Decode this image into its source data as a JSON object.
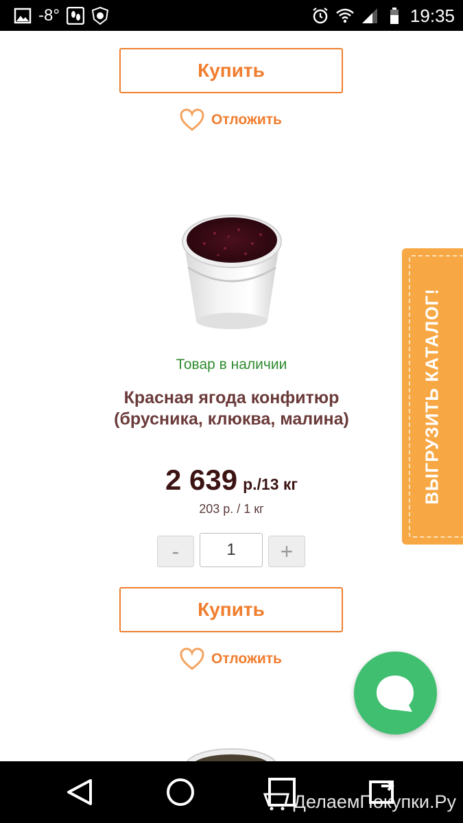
{
  "status_bar": {
    "temperature": "-8°",
    "time": "19:35",
    "icons": [
      "image-icon",
      "footprints-icon",
      "antivirus-icon",
      "alarm-icon",
      "wifi-icon",
      "signal-icon",
      "battery-icon"
    ]
  },
  "previous_product": {
    "buy_label": "Купить",
    "postpone_label": "Отложить"
  },
  "product": {
    "availability": "Товар в наличии",
    "title": "Красная ягода конфитюр (брусника, клюква, малина)",
    "price": "2 639",
    "price_unit": "р./13 кг",
    "price_per_unit": "203 р. / 1 кг",
    "quantity": {
      "minus_label": "-",
      "value": "1",
      "plus_label": "+"
    },
    "buy_label": "Купить",
    "postpone_label": "Отложить"
  },
  "side_banner": {
    "label": "ВЫГРУЗИТЬ КАТАЛОГ!"
  },
  "nav_bar": {
    "icons": [
      "back-icon",
      "home-icon",
      "recents-icon",
      "screen-share-icon"
    ],
    "watermark": "ДелаемПокупки.Ру"
  },
  "colors": {
    "accent": "#f07d2e",
    "in_stock": "#2e8b2e",
    "title": "#6b3a3a",
    "price": "#3d1414",
    "chat_fab": "#3fbf6f",
    "banner": "#f7a845"
  }
}
